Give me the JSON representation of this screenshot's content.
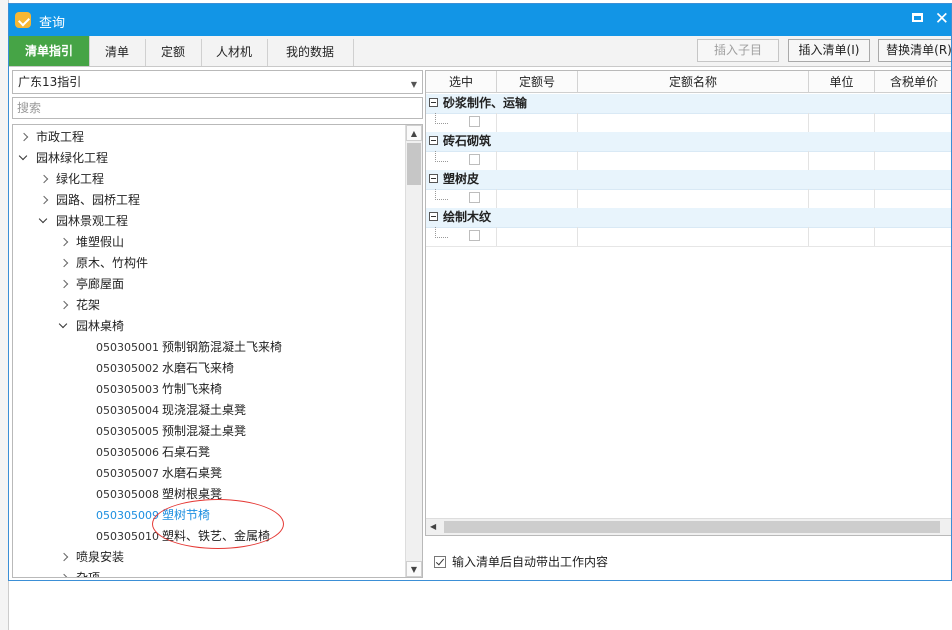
{
  "window": {
    "title": "查询",
    "icon": "app-logo-icon",
    "controls": {
      "maximize": "maximize-icon",
      "close": "close-icon"
    }
  },
  "tabs": [
    {
      "label": "清单指引",
      "active": true
    },
    {
      "label": "清单",
      "active": false
    },
    {
      "label": "定额",
      "active": false
    },
    {
      "label": "人材机",
      "active": false
    },
    {
      "label": "我的数据",
      "active": false
    }
  ],
  "toolbar": {
    "insert_child": "插入子目",
    "insert_list": "插入清单(I)",
    "replace_list": "替换清单(R)"
  },
  "left": {
    "category_selected": "广东13指引",
    "search_placeholder": "搜索",
    "tree": [
      {
        "label": "市政工程",
        "level": 0,
        "state": "collapsed"
      },
      {
        "label": "园林绿化工程",
        "level": 0,
        "state": "expanded"
      },
      {
        "label": "绿化工程",
        "level": 1,
        "state": "collapsed"
      },
      {
        "label": "园路、园桥工程",
        "level": 1,
        "state": "collapsed"
      },
      {
        "label": "园林景观工程",
        "level": 1,
        "state": "expanded"
      },
      {
        "label": "堆塑假山",
        "level": 2,
        "state": "collapsed"
      },
      {
        "label": "原木、竹构件",
        "level": 2,
        "state": "collapsed"
      },
      {
        "label": "亭廊屋面",
        "level": 2,
        "state": "collapsed"
      },
      {
        "label": "花架",
        "level": 2,
        "state": "collapsed",
        "selected": true
      },
      {
        "label": "园林桌椅",
        "level": 2,
        "state": "expanded"
      },
      {
        "code": "050305001",
        "label": "预制钢筋混凝土飞来椅",
        "level": 3
      },
      {
        "code": "050305002",
        "label": "水磨石飞来椅",
        "level": 3
      },
      {
        "code": "050305003",
        "label": "竹制飞来椅",
        "level": 3
      },
      {
        "code": "050305004",
        "label": "现浇混凝土桌凳",
        "level": 3
      },
      {
        "code": "050305005",
        "label": "预制混凝土桌凳",
        "level": 3
      },
      {
        "code": "050305006",
        "label": "石桌石凳",
        "level": 3
      },
      {
        "code": "050305007",
        "label": "水磨石桌凳",
        "level": 3
      },
      {
        "code": "050305008",
        "label": "塑树根桌凳",
        "level": 3
      },
      {
        "code": "050305009",
        "label": "塑树节椅",
        "level": 3,
        "highlighted": true
      },
      {
        "code": "050305010",
        "label": "塑料、铁艺、金属椅",
        "level": 3
      },
      {
        "label": "喷泉安装",
        "level": 2,
        "state": "collapsed"
      },
      {
        "label": "杂项",
        "level": 2,
        "state": "collapsed"
      }
    ]
  },
  "right": {
    "columns": [
      "选中",
      "定额号",
      "定额名称",
      "单位",
      "含税单价"
    ],
    "groups": [
      "砂浆制作、运输",
      "砖石砌筑",
      "塑树皮",
      "绘制木纹"
    ],
    "auto_fill_label": "输入清单后自动带出工作内容",
    "auto_fill_checked": true
  },
  "colors": {
    "titlebar": "#1295e6",
    "active_tab": "#46a446",
    "tree_selection": "#9ed4ff",
    "highlight_text": "#1d8fe0",
    "annotation_circle": "#e53935"
  }
}
